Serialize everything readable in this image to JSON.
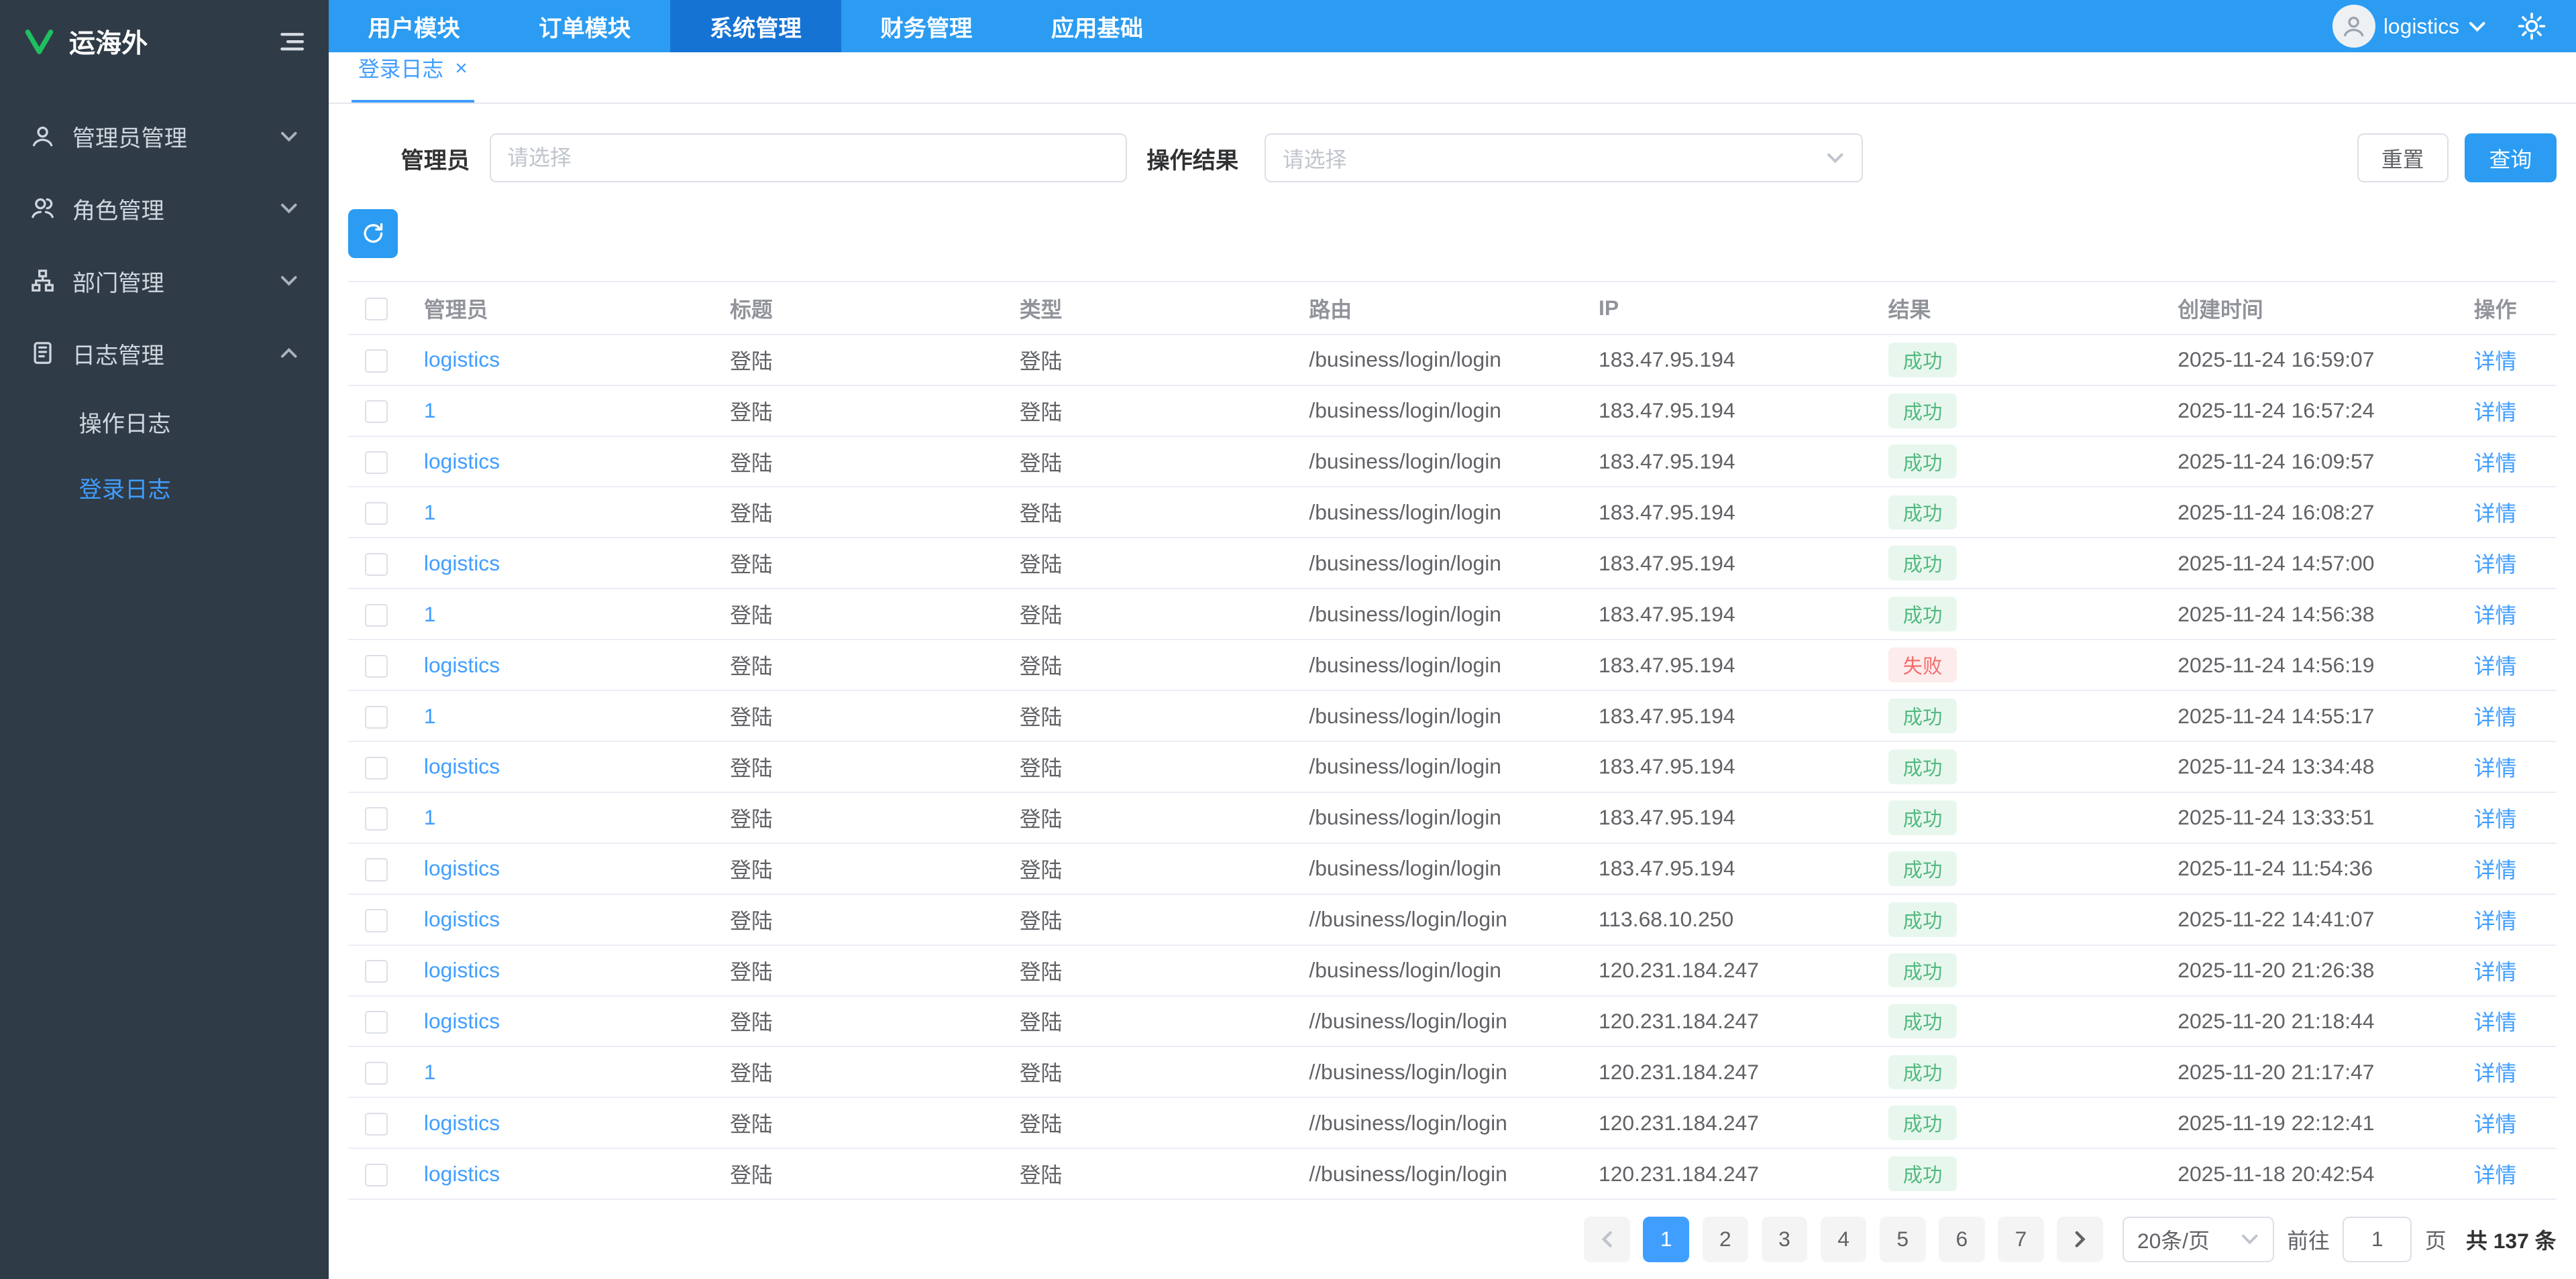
{
  "brand": {
    "name": "运海外"
  },
  "topnav": {
    "items": [
      {
        "label": "用户模块"
      },
      {
        "label": "订单模块"
      },
      {
        "label": "系统管理",
        "state": "active"
      },
      {
        "label": "财务管理"
      },
      {
        "label": "应用基础"
      }
    ],
    "username": "logistics"
  },
  "sidebar": {
    "items": [
      {
        "label": "管理员管理",
        "icon": "admin-icon"
      },
      {
        "label": "角色管理",
        "icon": "role-icon"
      },
      {
        "label": "部门管理",
        "icon": "department-icon"
      },
      {
        "label": "日志管理",
        "icon": "log-icon",
        "children": [
          {
            "label": "操作日志"
          },
          {
            "label": "登录日志",
            "state": "active"
          }
        ]
      }
    ]
  },
  "tabs": {
    "active_tab": "登录日志"
  },
  "filters": {
    "admin_label": "管理员",
    "admin_placeholder": "请选择",
    "result_label": "操作结果",
    "result_placeholder": "请选择",
    "reset_label": "重置",
    "search_label": "查询"
  },
  "table": {
    "headers": [
      "管理员",
      "标题",
      "类型",
      "路由",
      "IP",
      "结果",
      "创建时间",
      "操作"
    ],
    "detail_label": "详情",
    "rows": [
      {
        "admin": "logistics",
        "title": "登陆",
        "type": "登陆",
        "route": "/business/login/login",
        "ip": "183.47.95.194",
        "result": "成功",
        "result_type": "success",
        "time": "2025-11-24 16:59:07"
      },
      {
        "admin": "1",
        "title": "登陆",
        "type": "登陆",
        "route": "/business/login/login",
        "ip": "183.47.95.194",
        "result": "成功",
        "result_type": "success",
        "time": "2025-11-24 16:57:24"
      },
      {
        "admin": "logistics",
        "title": "登陆",
        "type": "登陆",
        "route": "/business/login/login",
        "ip": "183.47.95.194",
        "result": "成功",
        "result_type": "success",
        "time": "2025-11-24 16:09:57"
      },
      {
        "admin": "1",
        "title": "登陆",
        "type": "登陆",
        "route": "/business/login/login",
        "ip": "183.47.95.194",
        "result": "成功",
        "result_type": "success",
        "time": "2025-11-24 16:08:27"
      },
      {
        "admin": "logistics",
        "title": "登陆",
        "type": "登陆",
        "route": "/business/login/login",
        "ip": "183.47.95.194",
        "result": "成功",
        "result_type": "success",
        "time": "2025-11-24 14:57:00"
      },
      {
        "admin": "1",
        "title": "登陆",
        "type": "登陆",
        "route": "/business/login/login",
        "ip": "183.47.95.194",
        "result": "成功",
        "result_type": "success",
        "time": "2025-11-24 14:56:38"
      },
      {
        "admin": "logistics",
        "title": "登陆",
        "type": "登陆",
        "route": "/business/login/login",
        "ip": "183.47.95.194",
        "result": "失败",
        "result_type": "fail",
        "time": "2025-11-24 14:56:19"
      },
      {
        "admin": "1",
        "title": "登陆",
        "type": "登陆",
        "route": "/business/login/login",
        "ip": "183.47.95.194",
        "result": "成功",
        "result_type": "success",
        "time": "2025-11-24 14:55:17"
      },
      {
        "admin": "logistics",
        "title": "登陆",
        "type": "登陆",
        "route": "/business/login/login",
        "ip": "183.47.95.194",
        "result": "成功",
        "result_type": "success",
        "time": "2025-11-24 13:34:48"
      },
      {
        "admin": "1",
        "title": "登陆",
        "type": "登陆",
        "route": "/business/login/login",
        "ip": "183.47.95.194",
        "result": "成功",
        "result_type": "success",
        "time": "2025-11-24 13:33:51"
      },
      {
        "admin": "logistics",
        "title": "登陆",
        "type": "登陆",
        "route": "/business/login/login",
        "ip": "183.47.95.194",
        "result": "成功",
        "result_type": "success",
        "time": "2025-11-24 11:54:36"
      },
      {
        "admin": "logistics",
        "title": "登陆",
        "type": "登陆",
        "route": "//business/login/login",
        "ip": "113.68.10.250",
        "result": "成功",
        "result_type": "success",
        "time": "2025-11-22 14:41:07"
      },
      {
        "admin": "logistics",
        "title": "登陆",
        "type": "登陆",
        "route": "/business/login/login",
        "ip": "120.231.184.247",
        "result": "成功",
        "result_type": "success",
        "time": "2025-11-20 21:26:38"
      },
      {
        "admin": "logistics",
        "title": "登陆",
        "type": "登陆",
        "route": "//business/login/login",
        "ip": "120.231.184.247",
        "result": "成功",
        "result_type": "success",
        "time": "2025-11-20 21:18:44"
      },
      {
        "admin": "1",
        "title": "登陆",
        "type": "登陆",
        "route": "//business/login/login",
        "ip": "120.231.184.247",
        "result": "成功",
        "result_type": "success",
        "time": "2025-11-20 21:17:47"
      },
      {
        "admin": "logistics",
        "title": "登陆",
        "type": "登陆",
        "route": "//business/login/login",
        "ip": "120.231.184.247",
        "result": "成功",
        "result_type": "success",
        "time": "2025-11-19 22:12:41"
      },
      {
        "admin": "logistics",
        "title": "登陆",
        "type": "登陆",
        "route": "//business/login/login",
        "ip": "120.231.184.247",
        "result": "成功",
        "result_type": "success",
        "time": "2025-11-18 20:42:54"
      }
    ]
  },
  "pagination": {
    "pages": [
      {
        "label": "1",
        "state": "active"
      },
      {
        "label": "2"
      },
      {
        "label": "3"
      },
      {
        "label": "4"
      },
      {
        "label": "5"
      },
      {
        "label": "6"
      },
      {
        "label": "7"
      }
    ],
    "page_size": "20条/页",
    "goto_label": "前往",
    "goto_value": "1",
    "page_unit": "页",
    "total": "共 137 条"
  },
  "colors": {
    "primary": "#2b9cf2",
    "nav_active": "#1573d4",
    "link": "#409eff",
    "success": "#52b97f",
    "fail": "#f56c6c"
  }
}
